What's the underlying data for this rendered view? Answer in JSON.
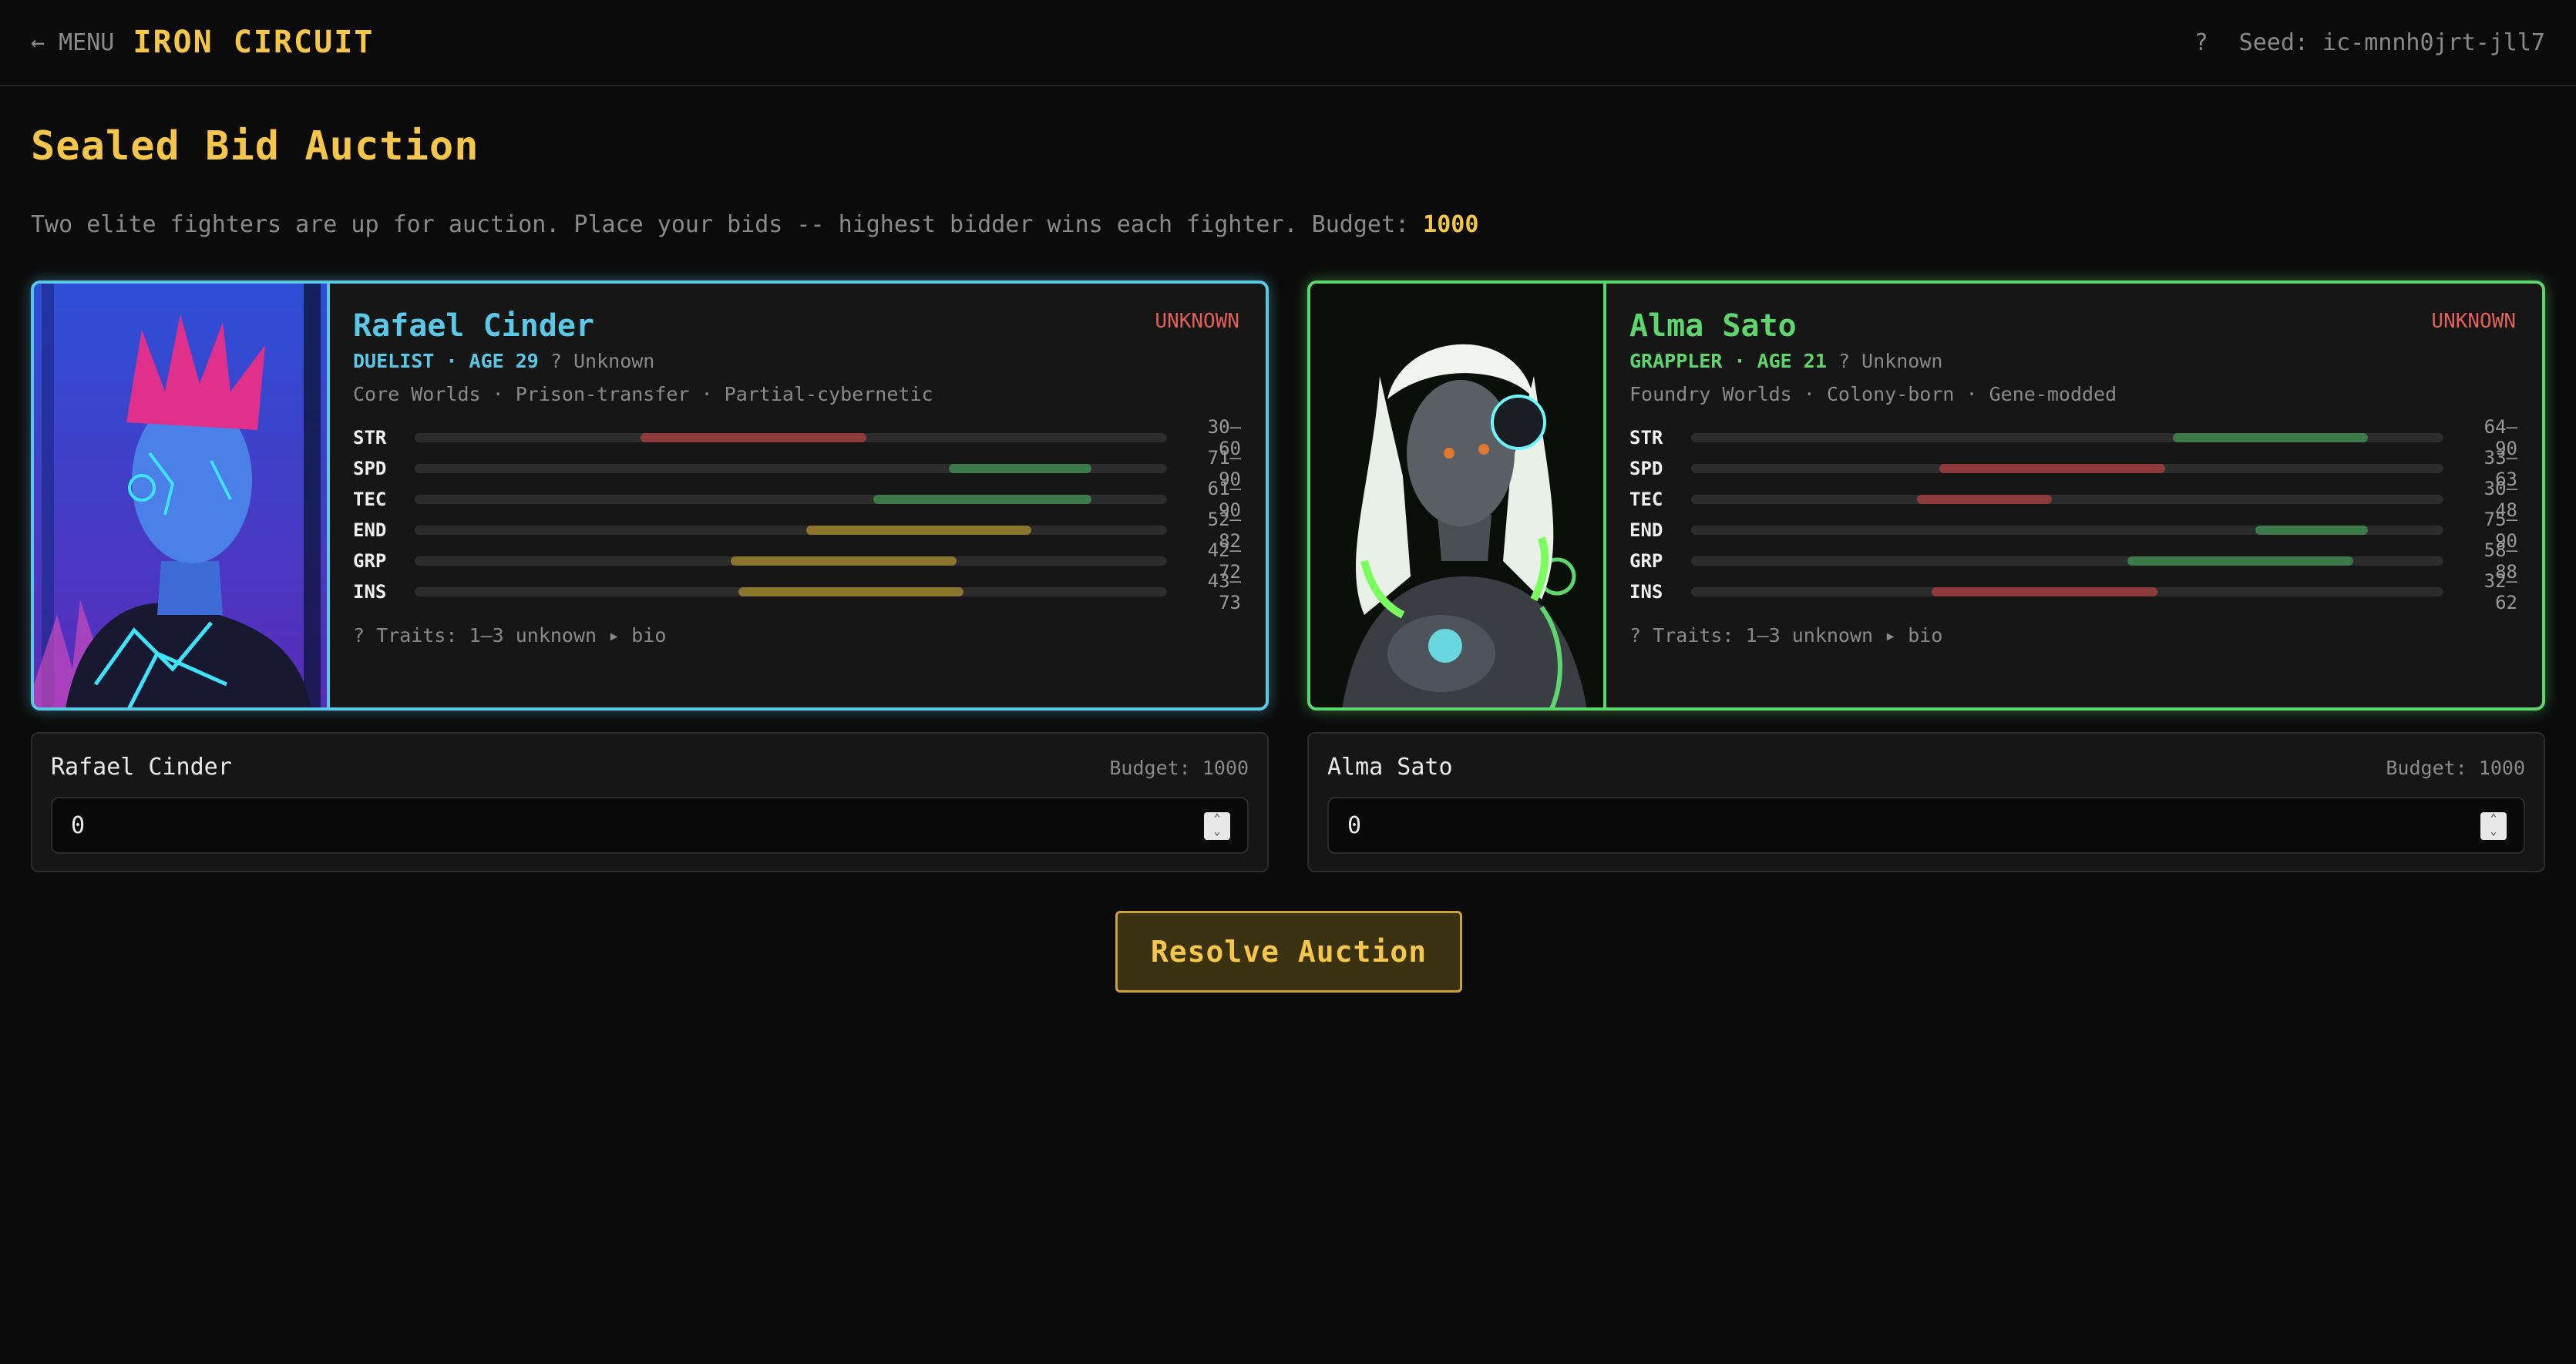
{
  "header": {
    "menu_label": "← MENU",
    "title": "IRON CIRCUIT",
    "help_label": "?",
    "seed_text": "Seed: ic-mnnh0jrt-jll7"
  },
  "page": {
    "title": "Sealed Bid Auction",
    "intro_text": "Two elite fighters are up for auction. Place your bids -- highest bidder wins each fighter. Budget:",
    "budget_value": "1000"
  },
  "fighters": [
    {
      "name": "Rafael Cinder",
      "status": "UNKNOWN",
      "class_age": "DUELIST · AGE 29",
      "unknown_note": "? Unknown",
      "origin": "Core Worlds · Prison-transfer · Partial-cybernetic",
      "stats": [
        {
          "name": "STR",
          "range": "30–60",
          "low": 30,
          "high": 60,
          "color": "red"
        },
        {
          "name": "SPD",
          "range": "71–90",
          "low": 71,
          "high": 90,
          "color": "green"
        },
        {
          "name": "TEC",
          "range": "61–90",
          "low": 61,
          "high": 90,
          "color": "green"
        },
        {
          "name": "END",
          "range": "52–82",
          "low": 52,
          "high": 82,
          "color": "yellow"
        },
        {
          "name": "GRP",
          "range": "42–72",
          "low": 42,
          "high": 72,
          "color": "yellow"
        },
        {
          "name": "INS",
          "range": "43–73",
          "low": 43,
          "high": 73,
          "color": "yellow"
        }
      ],
      "traits": "? Traits: 1–3 unknown ▸ bio",
      "accent_color": "#5bc8e6",
      "bid_label": "Rafael Cinder",
      "bid_budget": "Budget: 1000",
      "bid_value": "0"
    },
    {
      "name": "Alma Sato",
      "status": "UNKNOWN",
      "class_age": "GRAPPLER · AGE 21",
      "unknown_note": "? Unknown",
      "origin": "Foundry Worlds · Colony-born · Gene-modded",
      "stats": [
        {
          "name": "STR",
          "range": "64–90",
          "low": 64,
          "high": 90,
          "color": "green"
        },
        {
          "name": "SPD",
          "range": "33–63",
          "low": 33,
          "high": 63,
          "color": "red"
        },
        {
          "name": "TEC",
          "range": "30–48",
          "low": 30,
          "high": 48,
          "color": "red"
        },
        {
          "name": "END",
          "range": "75–90",
          "low": 75,
          "high": 90,
          "color": "green"
        },
        {
          "name": "GRP",
          "range": "58–88",
          "low": 58,
          "high": 88,
          "color": "green"
        },
        {
          "name": "INS",
          "range": "32–62",
          "low": 32,
          "high": 62,
          "color": "red"
        }
      ],
      "traits": "? Traits: 1–3 unknown ▸ bio",
      "accent_color": "#5fd66d",
      "bid_label": "Alma Sato",
      "bid_budget": "Budget: 1000",
      "bid_value": "0"
    }
  ],
  "actions": {
    "resolve_label": "Resolve Auction"
  },
  "colors": {
    "gold": "#f5c64a",
    "unknown_status": "#e0605a",
    "bar_red": "#8e3b3b",
    "bar_green": "#3d7a4b",
    "bar_yellow": "#8a7530"
  }
}
